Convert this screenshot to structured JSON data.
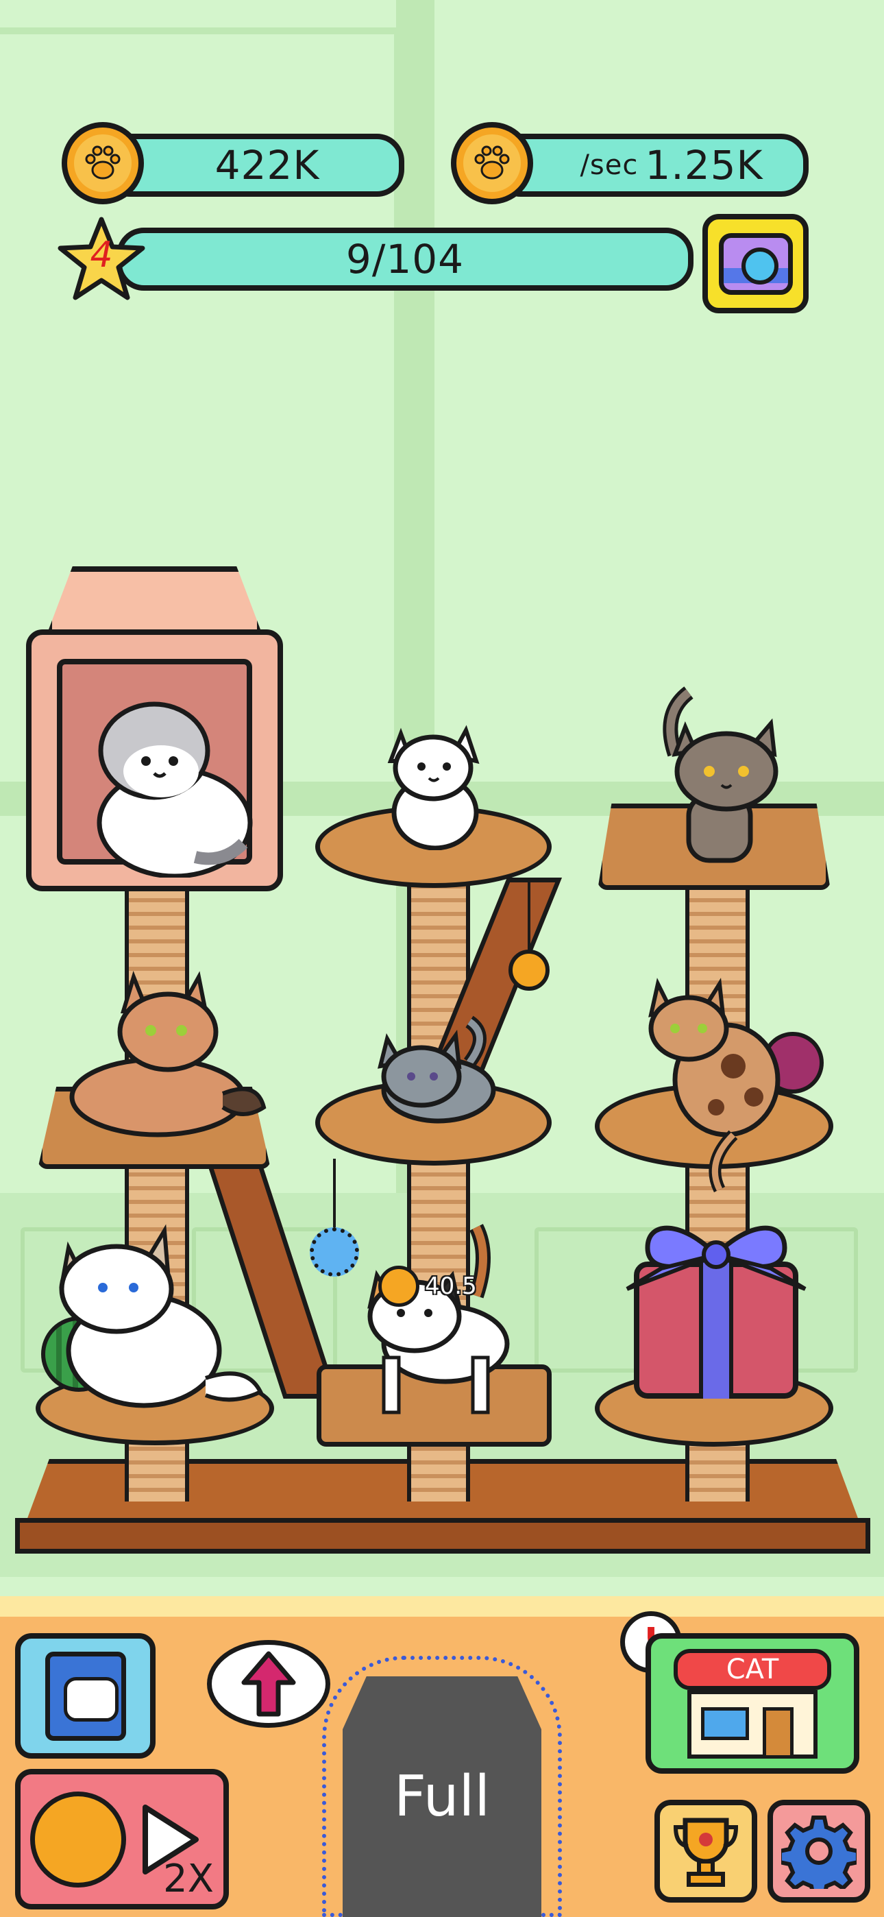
{
  "hud": {
    "coins": "422K",
    "rate_unit": "/sec",
    "rate_value": "1.25K",
    "level": "4",
    "collection": "9/104"
  },
  "floating_reward": "40.5",
  "bottom": {
    "carrier_label": "Full",
    "boost_label": "2X",
    "shop_sign": "CAT",
    "alert_mark": "!"
  },
  "colors": {
    "background": "#d4f5cc",
    "hud_bar": "#7fe8d2",
    "coin": "#f5a623",
    "star": "#f9d54a",
    "level_text": "#e02020",
    "bottom_bar": "#f9b768"
  },
  "icons": [
    "paw-coin-icon",
    "star-icon",
    "camera-icon",
    "cat-book-icon",
    "upgrade-arrow-icon",
    "cat-shop-icon",
    "trophy-icon",
    "gear-icon",
    "play-icon"
  ]
}
